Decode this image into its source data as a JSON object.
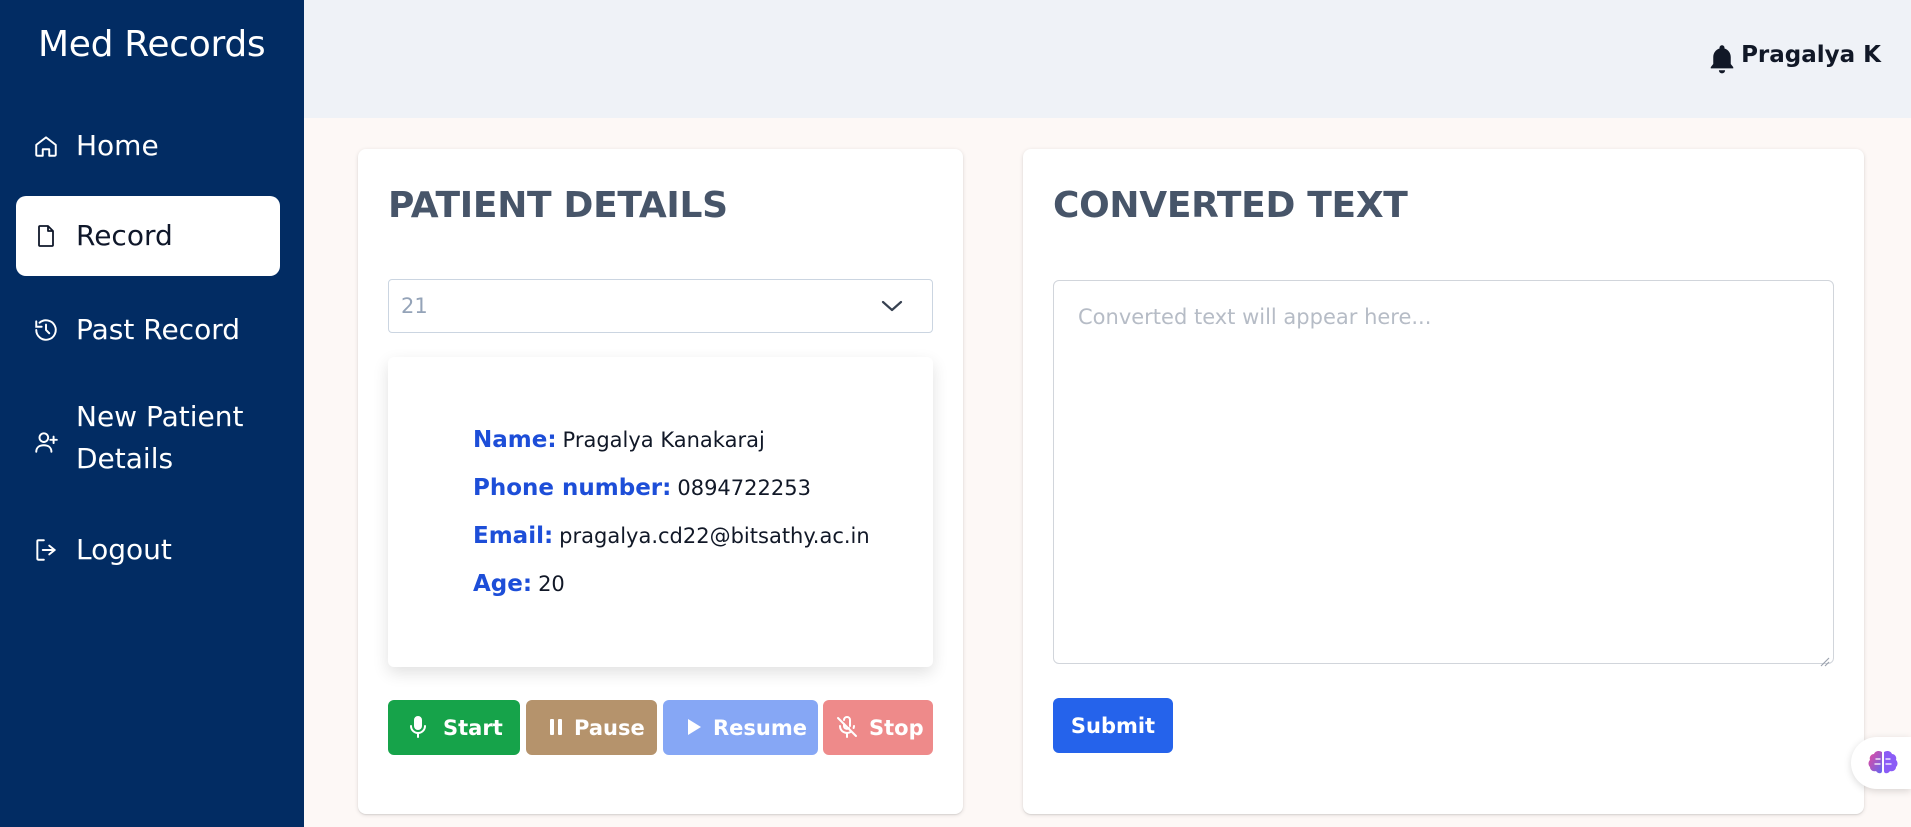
{
  "app": {
    "brand": "Med Records"
  },
  "sidebar": {
    "items": [
      {
        "label": "Home",
        "icon": "home-icon"
      },
      {
        "label": "Record",
        "icon": "file-icon",
        "active": true
      },
      {
        "label": "Past Record",
        "icon": "history-icon"
      },
      {
        "label": "New Patient Details",
        "icon": "user-plus-icon"
      },
      {
        "label": "Logout",
        "icon": "logout-icon"
      }
    ]
  },
  "header": {
    "user_name": "Pragalya K",
    "icon": "bell-icon"
  },
  "patient": {
    "title": "PATIENT DETAILS",
    "selected_id": "21",
    "fields": {
      "name_label": "Name:",
      "name_value": "Pragalya Kanakaraj",
      "phone_label": "Phone number:",
      "phone_value": "0894722253",
      "email_label": "Email:",
      "email_value": "pragalya.cd22@bitsathy.ac.in",
      "age_label": "Age:",
      "age_value": "20"
    },
    "buttons": {
      "start": "Start",
      "pause": "Pause",
      "resume": "Resume",
      "stop": "Stop"
    }
  },
  "converted": {
    "title": "CONVERTED TEXT",
    "placeholder": "Converted text will appear here...",
    "submit": "Submit"
  },
  "colors": {
    "sidebar": "#022c63",
    "start": "#16a34a",
    "pause": "#b5936c",
    "resume": "#86a7f5",
    "stop": "#ee8a8a",
    "submit": "#2563eb",
    "field_label": "#1d4ed8"
  }
}
